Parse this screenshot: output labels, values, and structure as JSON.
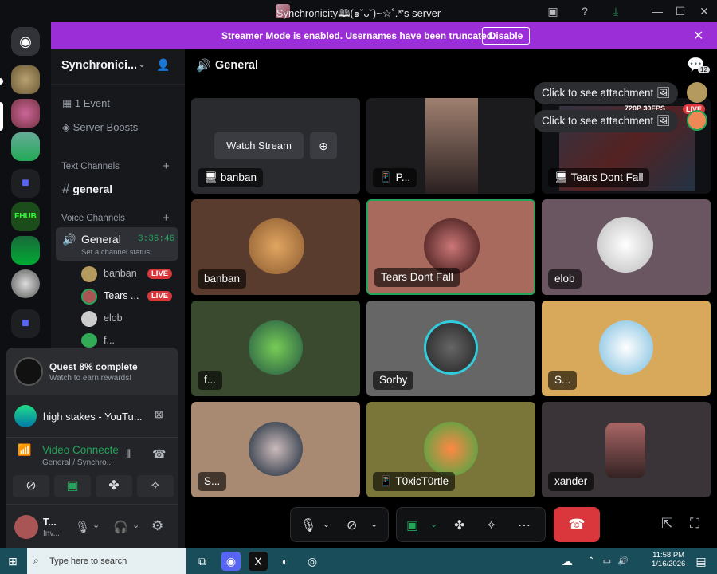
{
  "window": {
    "title": "Synchronicity🕮(๑˘ᴗ˘)~☆˚.*'s server"
  },
  "banner": {
    "text": "Streamer Mode is enabled. Usernames have been truncated.",
    "button": "Disable"
  },
  "server": {
    "name": "Synchronici..."
  },
  "sidebar": {
    "event": "1 Event",
    "boosts": "Server Boosts",
    "text_header": "Text Channels",
    "text_channel": "general",
    "voice_header": "Voice Channels",
    "voice_channel": {
      "name": "General",
      "timer": "3:36:46",
      "status_placeholder": "Set a channel status"
    },
    "members": [
      {
        "name": "banban",
        "live": "LIVE"
      },
      {
        "name": "Tears ...",
        "live": "LIVE"
      },
      {
        "name": "elob",
        "live": ""
      },
      {
        "name": "f...",
        "live": ""
      }
    ],
    "quest": {
      "title": "Quest 8% complete",
      "sub": "Watch to earn rewards!"
    },
    "activity": "high stakes - YouTu...",
    "voice": {
      "status": "Video Connecte",
      "location": "General / Synchro..."
    },
    "user": {
      "name": "T...",
      "sub": "Inv..."
    }
  },
  "main": {
    "channel": "General",
    "inbox_count": "12",
    "attach1": "Click to see attachment",
    "attach2": "Click to see attachment",
    "watch_stream": "Watch Stream",
    "live_badge": "LIVE",
    "overlay_text": "720P 30FPS",
    "tiles": [
      {
        "name": "banban"
      },
      {
        "name": "P..."
      },
      {
        "name": "Tears Dont Fall"
      },
      {
        "name": "banban"
      },
      {
        "name": "Tears Dont Fall"
      },
      {
        "name": "elob"
      },
      {
        "name": "f..."
      },
      {
        "name": "Sorby"
      },
      {
        "name": "S..."
      },
      {
        "name": "S..."
      },
      {
        "name": "T0xicT0rtle"
      },
      {
        "name": "xander"
      }
    ]
  },
  "taskbar": {
    "search": "Type here to search",
    "time": "11:58 PM",
    "date": "1/16/2026"
  },
  "colors": {
    "banner": "#9b2ed6",
    "live": "#da373c",
    "green": "#23a55a",
    "hangup": "#da373c"
  }
}
